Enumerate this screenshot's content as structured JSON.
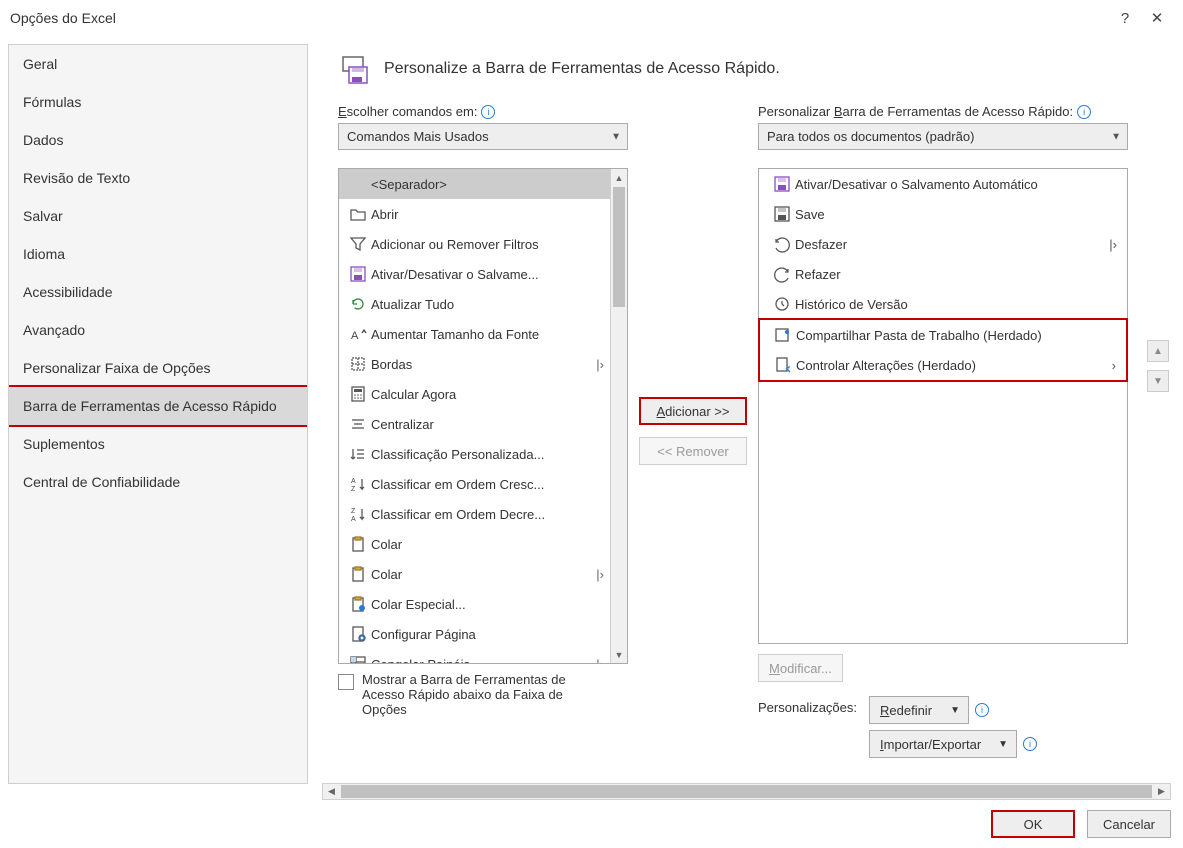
{
  "window_title": "Opções do Excel",
  "titlebar": {
    "help": "?",
    "close": "✕"
  },
  "sidebar": {
    "items": [
      {
        "label": "Geral"
      },
      {
        "label": "Fórmulas"
      },
      {
        "label": "Dados"
      },
      {
        "label": "Revisão de Texto"
      },
      {
        "label": "Salvar"
      },
      {
        "label": "Idioma"
      },
      {
        "label": "Acessibilidade"
      },
      {
        "label": "Avançado"
      },
      {
        "label": "Personalizar Faixa de Opções"
      },
      {
        "label": "Barra de Ferramentas de Acesso Rápido"
      },
      {
        "label": "Suplementos"
      },
      {
        "label": "Central de Confiabilidade"
      }
    ]
  },
  "header": {
    "text": "Personalize a Barra de Ferramentas de Acesso Rápido."
  },
  "leftcol": {
    "label_pre": "E",
    "label_rest": "scolher comandos em:",
    "select_value": "Comandos Mais Usados",
    "items": [
      {
        "label": "<Separador>",
        "selected": true,
        "icon": "separator"
      },
      {
        "label": "Abrir",
        "icon": "folder"
      },
      {
        "label": "Adicionar ou Remover Filtros",
        "icon": "funnel"
      },
      {
        "label": "Ativar/Desativar o Salvame...",
        "icon": "save-purple"
      },
      {
        "label": "Atualizar Tudo",
        "icon": "refresh"
      },
      {
        "label": "Aumentar Tamanho da Fonte",
        "icon": "font-up"
      },
      {
        "label": "Bordas",
        "icon": "borders",
        "submenu": true
      },
      {
        "label": "Calcular Agora",
        "icon": "calculator"
      },
      {
        "label": "Centralizar",
        "icon": "center"
      },
      {
        "label": "Classificação Personalizada...",
        "icon": "sort-custom"
      },
      {
        "label": "Classificar em Ordem Cresc...",
        "icon": "sort-asc"
      },
      {
        "label": "Classificar em Ordem Decre...",
        "icon": "sort-desc"
      },
      {
        "label": "Colar",
        "icon": "paste"
      },
      {
        "label": "Colar",
        "icon": "paste",
        "submenu": true
      },
      {
        "label": "Colar Especial...",
        "icon": "paste-special"
      },
      {
        "label": "Configurar Página",
        "icon": "page-setup"
      },
      {
        "label": "Congelar Painéis",
        "icon": "freeze",
        "submenu": true
      }
    ]
  },
  "midcol": {
    "add": "Adicionar >>",
    "remove": "<< Remover"
  },
  "rightcol": {
    "label_pre": "Personalizar ",
    "label_under": "B",
    "label_rest": "arra de Ferramentas de Acesso Rápido:",
    "select_value": "Para todos os documentos (padrão)",
    "items": [
      {
        "label": "Ativar/Desativar o Salvamento Automático",
        "icon": "save-purple"
      },
      {
        "label": "Save",
        "icon": "save"
      },
      {
        "label": "Desfazer",
        "icon": "undo",
        "submenu": true
      },
      {
        "label": "Refazer",
        "icon": "redo"
      },
      {
        "label": "Histórico de Versão",
        "icon": "history"
      },
      {
        "label": "Compartilhar Pasta de Trabalho (Herdado)",
        "icon": "share",
        "highlight": true
      },
      {
        "label": "Controlar Alterações (Herdado)",
        "icon": "track",
        "submenu": true,
        "highlight": true
      }
    ],
    "modify": "Modificar...",
    "perso_label": "Personalizações:",
    "redefine": "Redefinir",
    "import_export": "Importar/Exportar"
  },
  "checkbox_text": "Mostrar a Barra de Ferramentas de Acesso Rápido abaixo da Faixa de Opções",
  "footer": {
    "ok": "OK",
    "cancel": "Cancelar"
  }
}
